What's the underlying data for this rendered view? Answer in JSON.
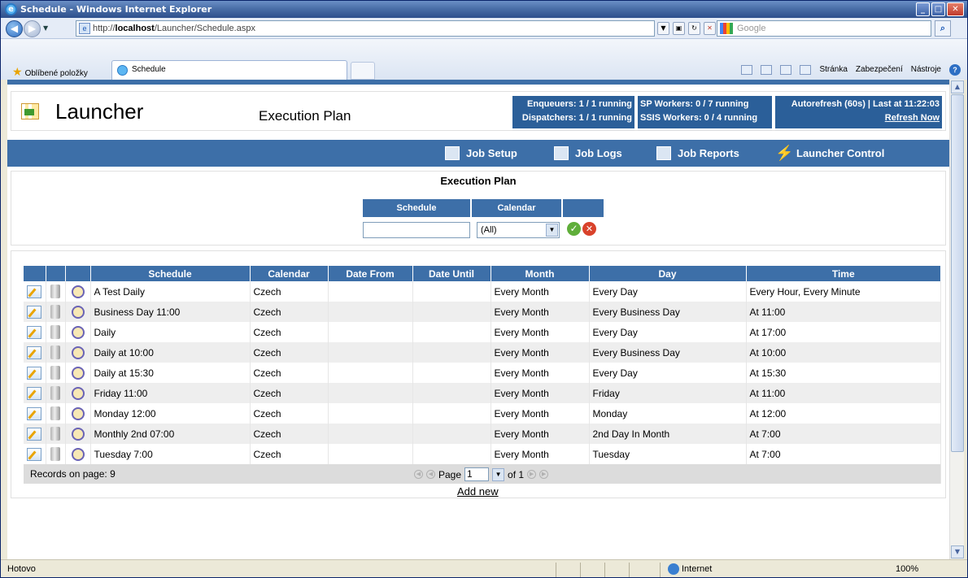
{
  "window": {
    "title": "Schedule - Windows Internet Explorer"
  },
  "browser": {
    "url_prefix": "http://",
    "url_host": "localhost",
    "url_path": "/Launcher/Schedule.aspx",
    "search_placeholder": "Google",
    "favorites_label": "Oblíbené položky",
    "tab_title": "Schedule",
    "cmd_page": "Stránka",
    "cmd_security": "Zabezpečení",
    "cmd_tools": "Nástroje",
    "status_text": "Hotovo",
    "zone_text": "Internet",
    "zoom_text": "100%"
  },
  "header": {
    "app_title": "Launcher",
    "page_title": "Execution Plan",
    "stat1_line1": "Enqueuers:   1 / 1 running",
    "stat1_line2": "Dispatchers: 1 / 1 running",
    "stat2_line1": "SP Workers:   0 / 7 running",
    "stat2_line2": "SSIS Workers: 0 / 4 running",
    "stat3_line1": "Autorefresh (60s) | Last at 11:22:03",
    "stat3_link": "Refresh Now"
  },
  "menu": {
    "job_setup": "Job Setup",
    "job_logs": "Job Logs",
    "job_reports": "Job Reports",
    "launcher_control": "Launcher Control"
  },
  "filter": {
    "title": "Execution Plan",
    "schedule_header": "Schedule",
    "calendar_header": "Calendar",
    "calendar_value": "(All)",
    "schedule_value": ""
  },
  "grid": {
    "columns": [
      "Schedule",
      "Calendar",
      "Date From",
      "Date Until",
      "Month",
      "Day",
      "Time"
    ],
    "rows": [
      {
        "schedule": "A Test Daily",
        "calendar": "Czech",
        "from": "",
        "until": "",
        "month": "Every Month",
        "day": "Every Day",
        "time": "Every Hour, Every Minute"
      },
      {
        "schedule": "Business Day 11:00",
        "calendar": "Czech",
        "from": "",
        "until": "",
        "month": "Every Month",
        "day": "Every Business Day",
        "time": "At 11:00"
      },
      {
        "schedule": "Daily",
        "calendar": "Czech",
        "from": "",
        "until": "",
        "month": "Every Month",
        "day": "Every Day",
        "time": "At 17:00"
      },
      {
        "schedule": "Daily at 10:00",
        "calendar": "Czech",
        "from": "",
        "until": "",
        "month": "Every Month",
        "day": "Every Business Day",
        "time": "At 10:00"
      },
      {
        "schedule": "Daily at 15:30",
        "calendar": "Czech",
        "from": "",
        "until": "",
        "month": "Every Month",
        "day": "Every Day",
        "time": "At 15:30"
      },
      {
        "schedule": "Friday 11:00",
        "calendar": "Czech",
        "from": "",
        "until": "",
        "month": "Every Month",
        "day": "Friday",
        "time": "At 11:00"
      },
      {
        "schedule": "Monday 12:00",
        "calendar": "Czech",
        "from": "",
        "until": "",
        "month": "Every Month",
        "day": "Monday",
        "time": "At 12:00"
      },
      {
        "schedule": "Monthly 2nd 07:00",
        "calendar": "Czech",
        "from": "",
        "until": "",
        "month": "Every Month",
        "day": "2nd Day In Month",
        "time": "At 7:00"
      },
      {
        "schedule": "Tuesday 7:00",
        "calendar": "Czech",
        "from": "",
        "until": "",
        "month": "Every Month",
        "day": "Tuesday",
        "time": "At 7:00"
      }
    ],
    "records_label": "Records on page: 9",
    "page_label": "Page",
    "page_value": "1",
    "of_label": "of 1",
    "add_new": "Add new"
  }
}
